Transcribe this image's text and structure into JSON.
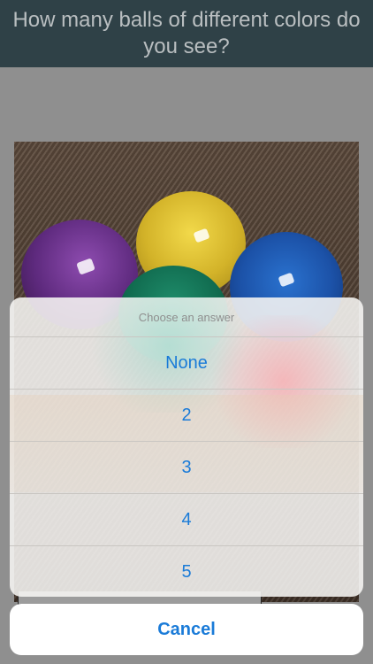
{
  "header": {
    "question": "How many balls of different colors do you see?"
  },
  "photo": {
    "balls": [
      {
        "name": "purple-ball",
        "color": "#6a3388"
      },
      {
        "name": "yellow-ball",
        "color": "#e3c33a"
      },
      {
        "name": "blue-ball",
        "color": "#1d5bb7"
      },
      {
        "name": "green-ball",
        "color": "#137457"
      }
    ]
  },
  "action_sheet": {
    "title": "Choose an answer",
    "options": [
      {
        "label": "None"
      },
      {
        "label": "2"
      },
      {
        "label": "3"
      },
      {
        "label": "4"
      },
      {
        "label": "5"
      }
    ],
    "cancel_label": "Cancel",
    "accent_color": "#1a7bd8"
  }
}
